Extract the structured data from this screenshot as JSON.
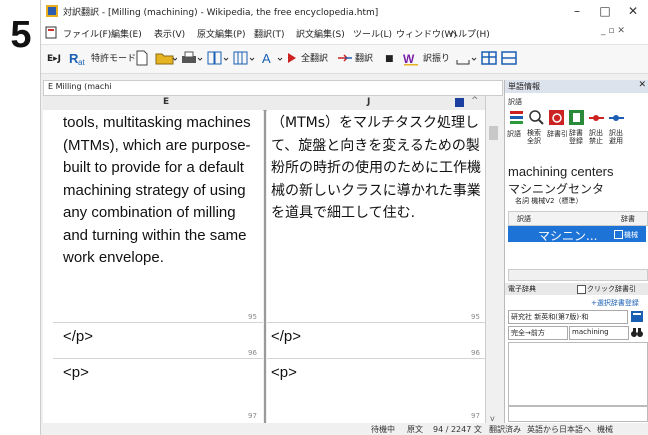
{
  "step_number": "5",
  "window": {
    "title": "対訳翻訳 - [Milling (machining) - Wikipedia, the free encyclopedia.htm]",
    "controls": [
      "–",
      "□",
      "✕"
    ]
  },
  "menu": {
    "items": [
      "ファイル(F)",
      "編集(E)",
      "表示(V)",
      "原文編集(P)",
      "翻訳(T)",
      "訳文編集(S)",
      "ツール(L)",
      "ウィンドウ(W)",
      "ヘルプ(H)"
    ],
    "mdi_controls": "_ ▫ ✕"
  },
  "toolbar": {
    "lang_pair": "E▸J",
    "mode": "特許モード",
    "full_translate": "全翻訳",
    "translate": "翻訳",
    "stop": "■",
    "recall": "訳振り"
  },
  "document": {
    "tab_label": "E  Milling (machi",
    "col_left": "E",
    "col_right": "J",
    "english_segment": "tools, multitasking machines (MTMs), which are purpose-built to provide for a default machining strategy of using any combination of milling and turning within the same work envelope.",
    "japanese_segment": "（MTMs）をマルチタスク処理して、旋盤と向きを変えるための製粉所の時折の使用のために工作機械の新しいクラスに導かれた事業を道具で細工して住む.",
    "seg95": "95",
    "seg96": "96",
    "seg97": "97",
    "close_p": "</p>",
    "open_p": "<p>"
  },
  "side_panel": {
    "title": "単語情報",
    "section": "訳語",
    "tool_labels": [
      "訳語",
      "検索 全訳",
      "辞書引",
      "辞書 登録",
      "訳出 禁止",
      "訳出 避用"
    ],
    "headword": "machining centers",
    "reading": "マシニングセンタ",
    "pos": "名詞  機械V2（標準）",
    "list_header_left": "訳語",
    "list_header_right": "辞書",
    "list_selected": "マシニン...",
    "list_selected_dict": "機械",
    "edict_title": "電子辞典",
    "click_lookup": "クリック辞書引",
    "select_register": "+選択辞書登録",
    "dict_name": "研究社 新英和(第7版)·和",
    "match_mode": "完全→前方",
    "query": "machining"
  },
  "status": {
    "state": "待機中",
    "view": "原文",
    "position": "94 / 2247 文",
    "translated": "翻訳済み",
    "direction": "英語から日本語へ",
    "field": "機械"
  },
  "colors": {
    "selection": "#1e73d6",
    "accent_blue": "#1a5fb4",
    "accent_red": "#cc2222"
  }
}
